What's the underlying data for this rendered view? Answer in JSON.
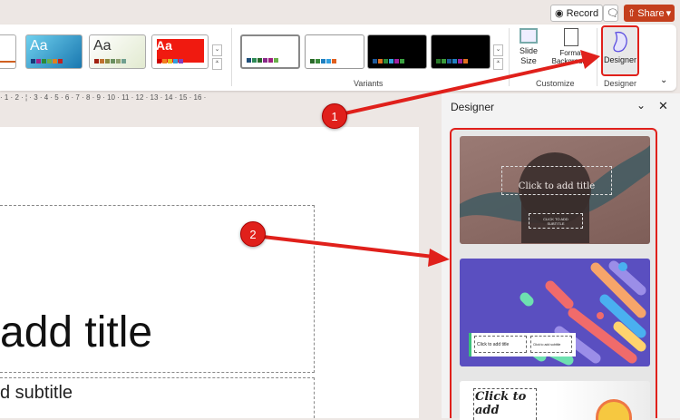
{
  "topbar": {
    "record": "Record",
    "share": "Share"
  },
  "ribbon": {
    "themes": [
      {
        "label": "Aa"
      },
      {
        "label": "Aa"
      },
      {
        "label": "Aa"
      }
    ],
    "groups": {
      "variants": "Variants",
      "customize": "Customize",
      "designer": "Designer"
    },
    "buttons": {
      "slide_size": "Slide Size",
      "format_background": "Format Background",
      "designer": "Designer"
    }
  },
  "ruler": "· 1 · 2 · ¦ · 3 · 4 · 5 · 6 · 7 · 8 · 9 · 10 · 11 · 12 · 13 · 14 · 15 · 16 ·",
  "slide": {
    "title": "add title",
    "subtitle": "d subtitle"
  },
  "designer_pane": {
    "title": "Designer",
    "designs": [
      {
        "title": "Click to add title",
        "subtitle": "CLICK TO ADD SUBTITLE"
      },
      {
        "title": "Click to add title",
        "subtitle": "Click to add subtitle"
      },
      {
        "title": "Click to add"
      }
    ]
  },
  "callouts": [
    "1",
    "2"
  ],
  "colors": {
    "accent": "#c43e1c",
    "annotation": "#e0201b"
  }
}
